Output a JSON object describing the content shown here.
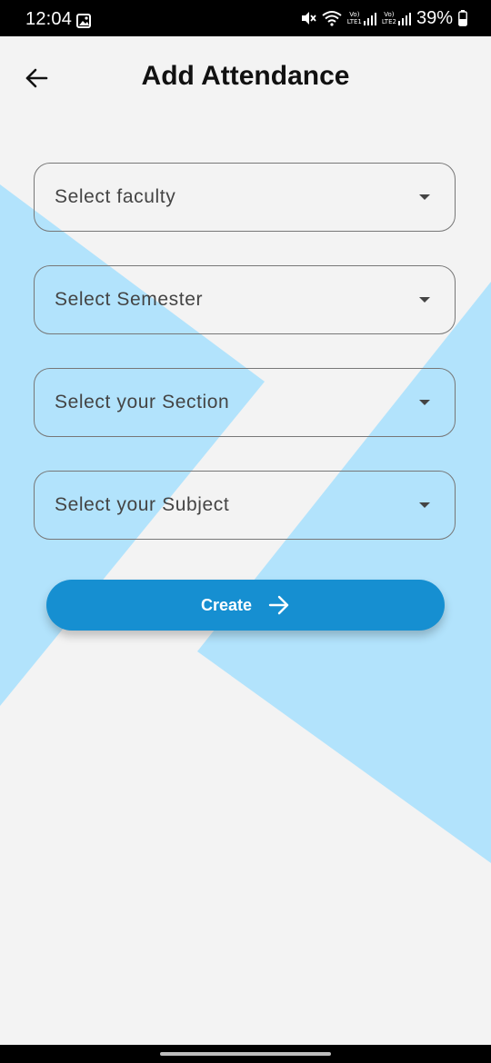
{
  "status_bar": {
    "time": "12:04",
    "battery": "39%",
    "sim1_label": "LTE1",
    "sim2_label": "LTE2",
    "icons": [
      "gallery-icon",
      "mute-icon",
      "wifi-icon",
      "signal-icon",
      "battery-icon"
    ]
  },
  "header": {
    "title": "Add Attendance",
    "back_icon": "arrow-left-icon"
  },
  "form": {
    "faculty": "Select faculty",
    "semester": "Select Semester",
    "section": "Select your Section",
    "subject": "Select your Subject"
  },
  "actions": {
    "create_label": "Create",
    "create_icon": "arrow-right-icon"
  },
  "colors": {
    "background": "#f3f3f3",
    "accent_shape": "#b2e3fc",
    "primary_button": "#168fd1"
  }
}
